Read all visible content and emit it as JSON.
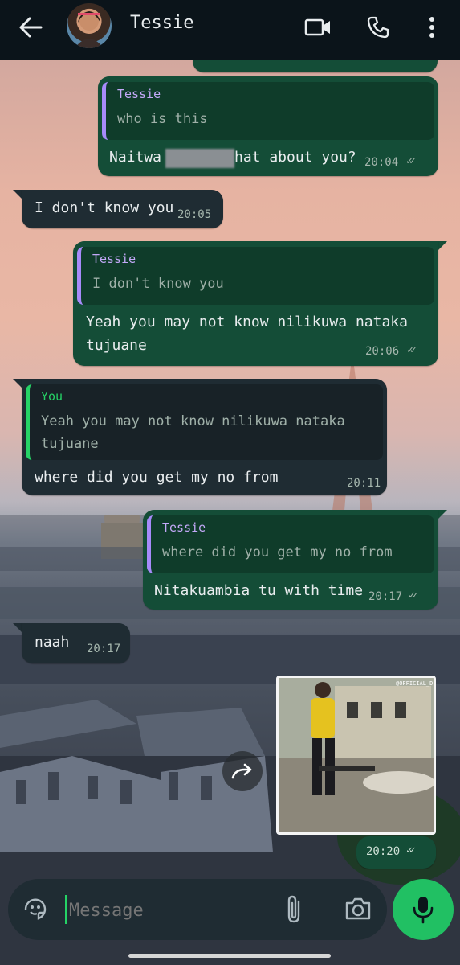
{
  "header": {
    "contact_name": "Tessie",
    "icons": [
      "back-arrow-icon",
      "video-call-icon",
      "phone-icon",
      "more-vert-icon"
    ]
  },
  "messages": [
    {
      "id": "m1",
      "direction": "out",
      "reply_to": {
        "name": "Tessie",
        "text": "who is this"
      },
      "text_before": "Naitwa",
      "text_after": "hat about you?",
      "time": "20:04",
      "ticks": "✓✓"
    },
    {
      "id": "m2",
      "direction": "in",
      "text": "I don't know you",
      "time": "20:05"
    },
    {
      "id": "m3",
      "direction": "out",
      "reply_to": {
        "name": "Tessie",
        "text": "I don't know you"
      },
      "text_line1": "Yeah you may not know nilikuwa nataka",
      "text_line2": "tujuane",
      "time": "20:06",
      "ticks": "✓✓"
    },
    {
      "id": "m4",
      "direction": "in",
      "reply_to": {
        "name": "You",
        "text_line1": "Yeah you may not know nilikuwa nataka",
        "text_line2": "tujuane"
      },
      "text": "where did you get my no from",
      "time": "20:11"
    },
    {
      "id": "m5",
      "direction": "out",
      "reply_to": {
        "name": "Tessie",
        "text": "where did you get my no from"
      },
      "text": "Nitakuambia tu with time",
      "time": "20:17",
      "ticks": "✓✓"
    },
    {
      "id": "m6",
      "direction": "in",
      "text": "naah",
      "time": "20:17"
    },
    {
      "id": "m7",
      "direction": "out",
      "media": "image",
      "watermark": "@OFFICIAL_DEZI",
      "time": "20:20",
      "ticks": "✓✓"
    }
  ],
  "composer": {
    "placeholder": "Message",
    "icons": [
      "sticker-icon",
      "attach-icon",
      "camera-icon",
      "mic-icon"
    ]
  }
}
